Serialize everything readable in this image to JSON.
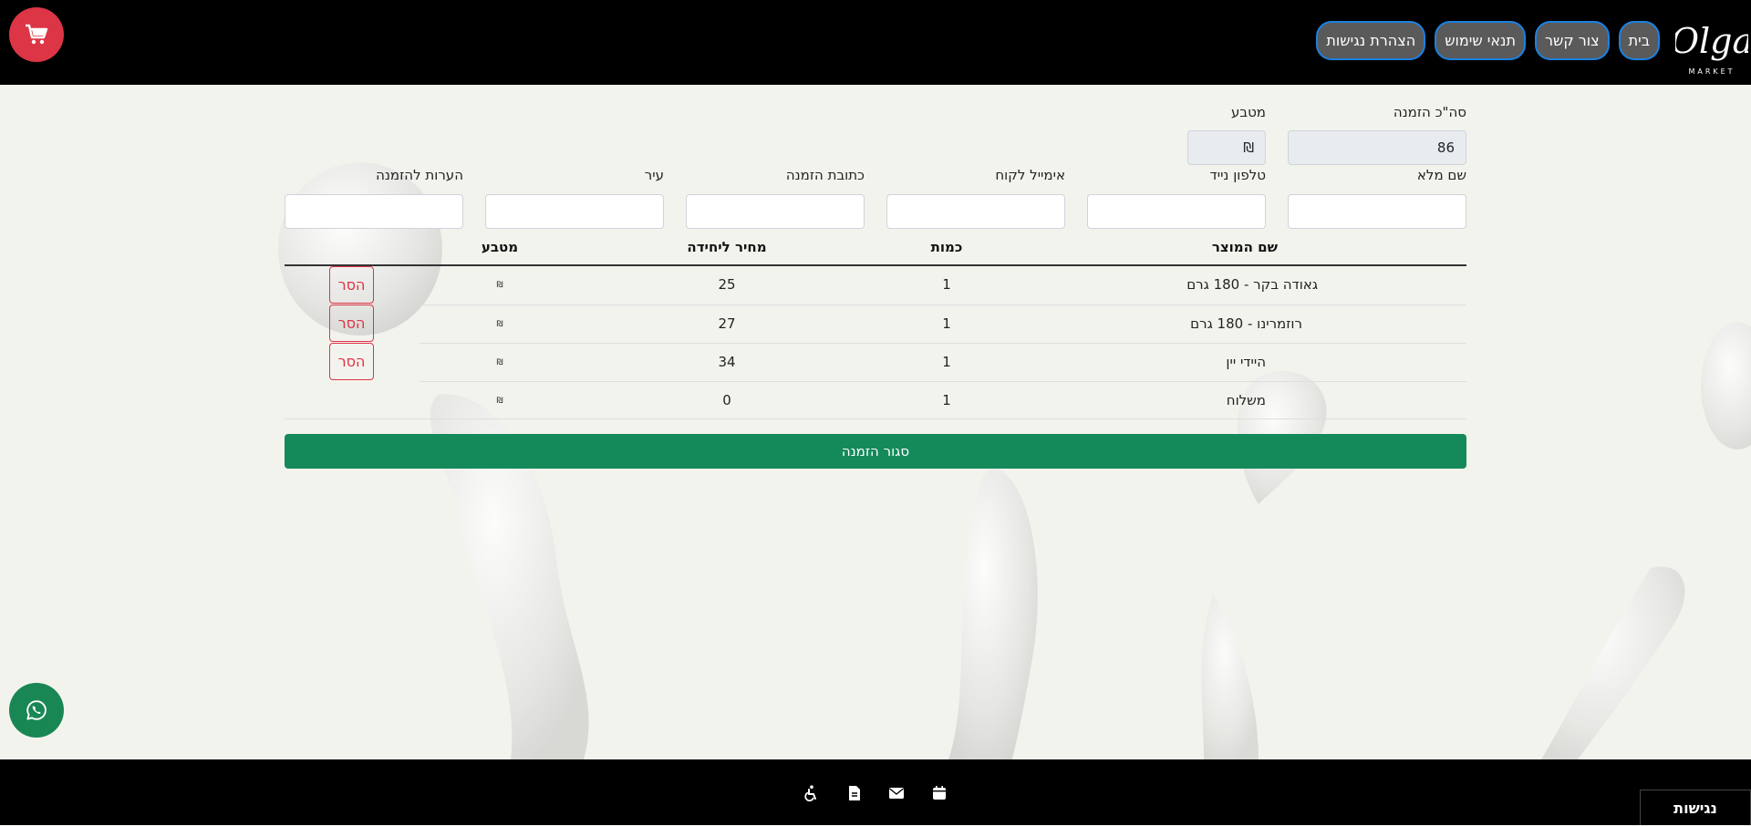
{
  "header": {
    "logo_text": "Olga",
    "logo_subtext": "MARKET",
    "nav": [
      "בית",
      "צור קשר",
      "תנאי שימוש",
      "הצהרת נגישות"
    ]
  },
  "order": {
    "total_label": "סה\"כ הזמנה",
    "total_value": "86",
    "currency_label": "מטבע",
    "currency_value": "₪"
  },
  "customer_fields": {
    "full_name_label": "שם מלא",
    "phone_label": "טלפון נייד",
    "email_label": "אימייל לקוח",
    "address_label": "כתובת הזמנה",
    "city_label": "עיר",
    "notes_label": "הערות להזמנה"
  },
  "table": {
    "headers": {
      "product": "שם המוצר",
      "qty": "כמות",
      "price": "מחיר ליחידה",
      "currency": "מטבע"
    },
    "rows": [
      {
        "name": "גאודה בקר - 180 גרם",
        "qty": "1",
        "price": "25",
        "currency": "₪",
        "remove": "הסר"
      },
      {
        "name": "רוזמרינו - 180 גרם",
        "qty": "1",
        "price": "27",
        "currency": "₪",
        "remove": "הסר"
      },
      {
        "name": "היידי יין",
        "qty": "1",
        "price": "34",
        "currency": "₪",
        "remove": "הסר"
      },
      {
        "name": "משלוח",
        "qty": "1",
        "price": "0",
        "currency": "₪"
      }
    ]
  },
  "submit_label": "סגור הזמנה",
  "footer": {
    "accessibility_label": "נגישות"
  },
  "colors": {
    "header_bg": "#000000",
    "nav_border": "#1a82e2",
    "cart": "#dc3545",
    "submit": "#148a5a",
    "whatsapp": "#198754",
    "remove": "#dc3545"
  },
  "icons": [
    "cart-icon",
    "whatsapp-icon",
    "accessibility-icon",
    "document-icon",
    "envelope-icon",
    "calendar-icon"
  ]
}
